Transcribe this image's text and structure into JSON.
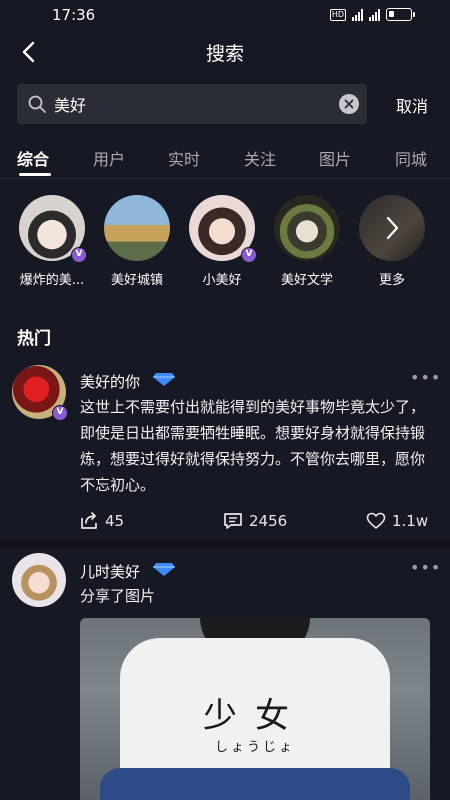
{
  "status_bar": {
    "time": "17:36",
    "hd": "HD",
    "signal_1": "5G",
    "signal_2": "5G",
    "battery_level": 0.25
  },
  "header": {
    "title": "搜索",
    "back_icon": "chevron-left-icon"
  },
  "search": {
    "value": "美好",
    "cancel_label": "取消"
  },
  "tabs": [
    {
      "label": "综合",
      "active": true
    },
    {
      "label": "用户",
      "active": false
    },
    {
      "label": "实时",
      "active": false
    },
    {
      "label": "关注",
      "active": false
    },
    {
      "label": "图片",
      "active": false
    },
    {
      "label": "同城",
      "active": false
    }
  ],
  "users": [
    {
      "name": "爆炸的美...",
      "verified": true
    },
    {
      "name": "美好城镇",
      "verified": false
    },
    {
      "name": "小美好",
      "verified": true
    },
    {
      "name": "美好文学",
      "verified": false
    },
    {
      "name": "更多",
      "verified": false
    }
  ],
  "section_title": "热门",
  "posts": [
    {
      "author": "美好的你",
      "vip": "VIP9",
      "verified": true,
      "text": "这世上不需要付出就能得到的美好事物毕竟太少了，即使是日出都需要牺牲睡眠。想要好身材就得保持锻炼，想要过得好就得保持努力。不管你去哪里，愿你不忘初心。",
      "shares": "45",
      "comments": "2456",
      "likes": "1.1w"
    },
    {
      "author": "儿时美好",
      "vip": "VIP9",
      "verified": false,
      "text": "分享了图片",
      "photo_text": "少女",
      "photo_subtext": "しょうじょ"
    }
  ],
  "colors": {
    "background": "#161823",
    "search_bg": "#2a2c36",
    "verified_badge": "#8b5bd6",
    "vip": "#5ab0ff"
  }
}
